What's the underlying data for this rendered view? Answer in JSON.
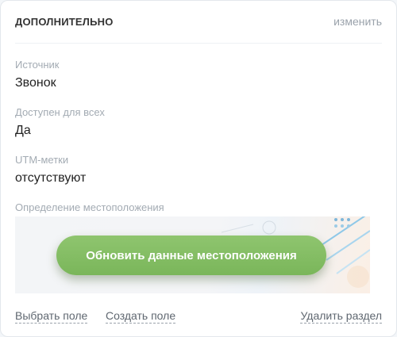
{
  "section": {
    "title": "ДОПОЛНИТЕЛЬНО",
    "edit_label": "изменить"
  },
  "fields": {
    "source": {
      "label": "Источник",
      "value": "Звонок"
    },
    "public": {
      "label": "Доступен для всех",
      "value": "Да"
    },
    "utm": {
      "label": "UTM-метки",
      "value": "отсутствуют"
    },
    "geo": {
      "label": "Определение местоположения"
    }
  },
  "geo_button_label": "Обновить данные местоположения",
  "footer": {
    "choose_field": "Выбрать поле",
    "create_field": "Создать поле",
    "delete_section": "Удалить раздел"
  },
  "colors": {
    "accent_green": "#7ab65a",
    "muted_text": "#a3abb3"
  }
}
